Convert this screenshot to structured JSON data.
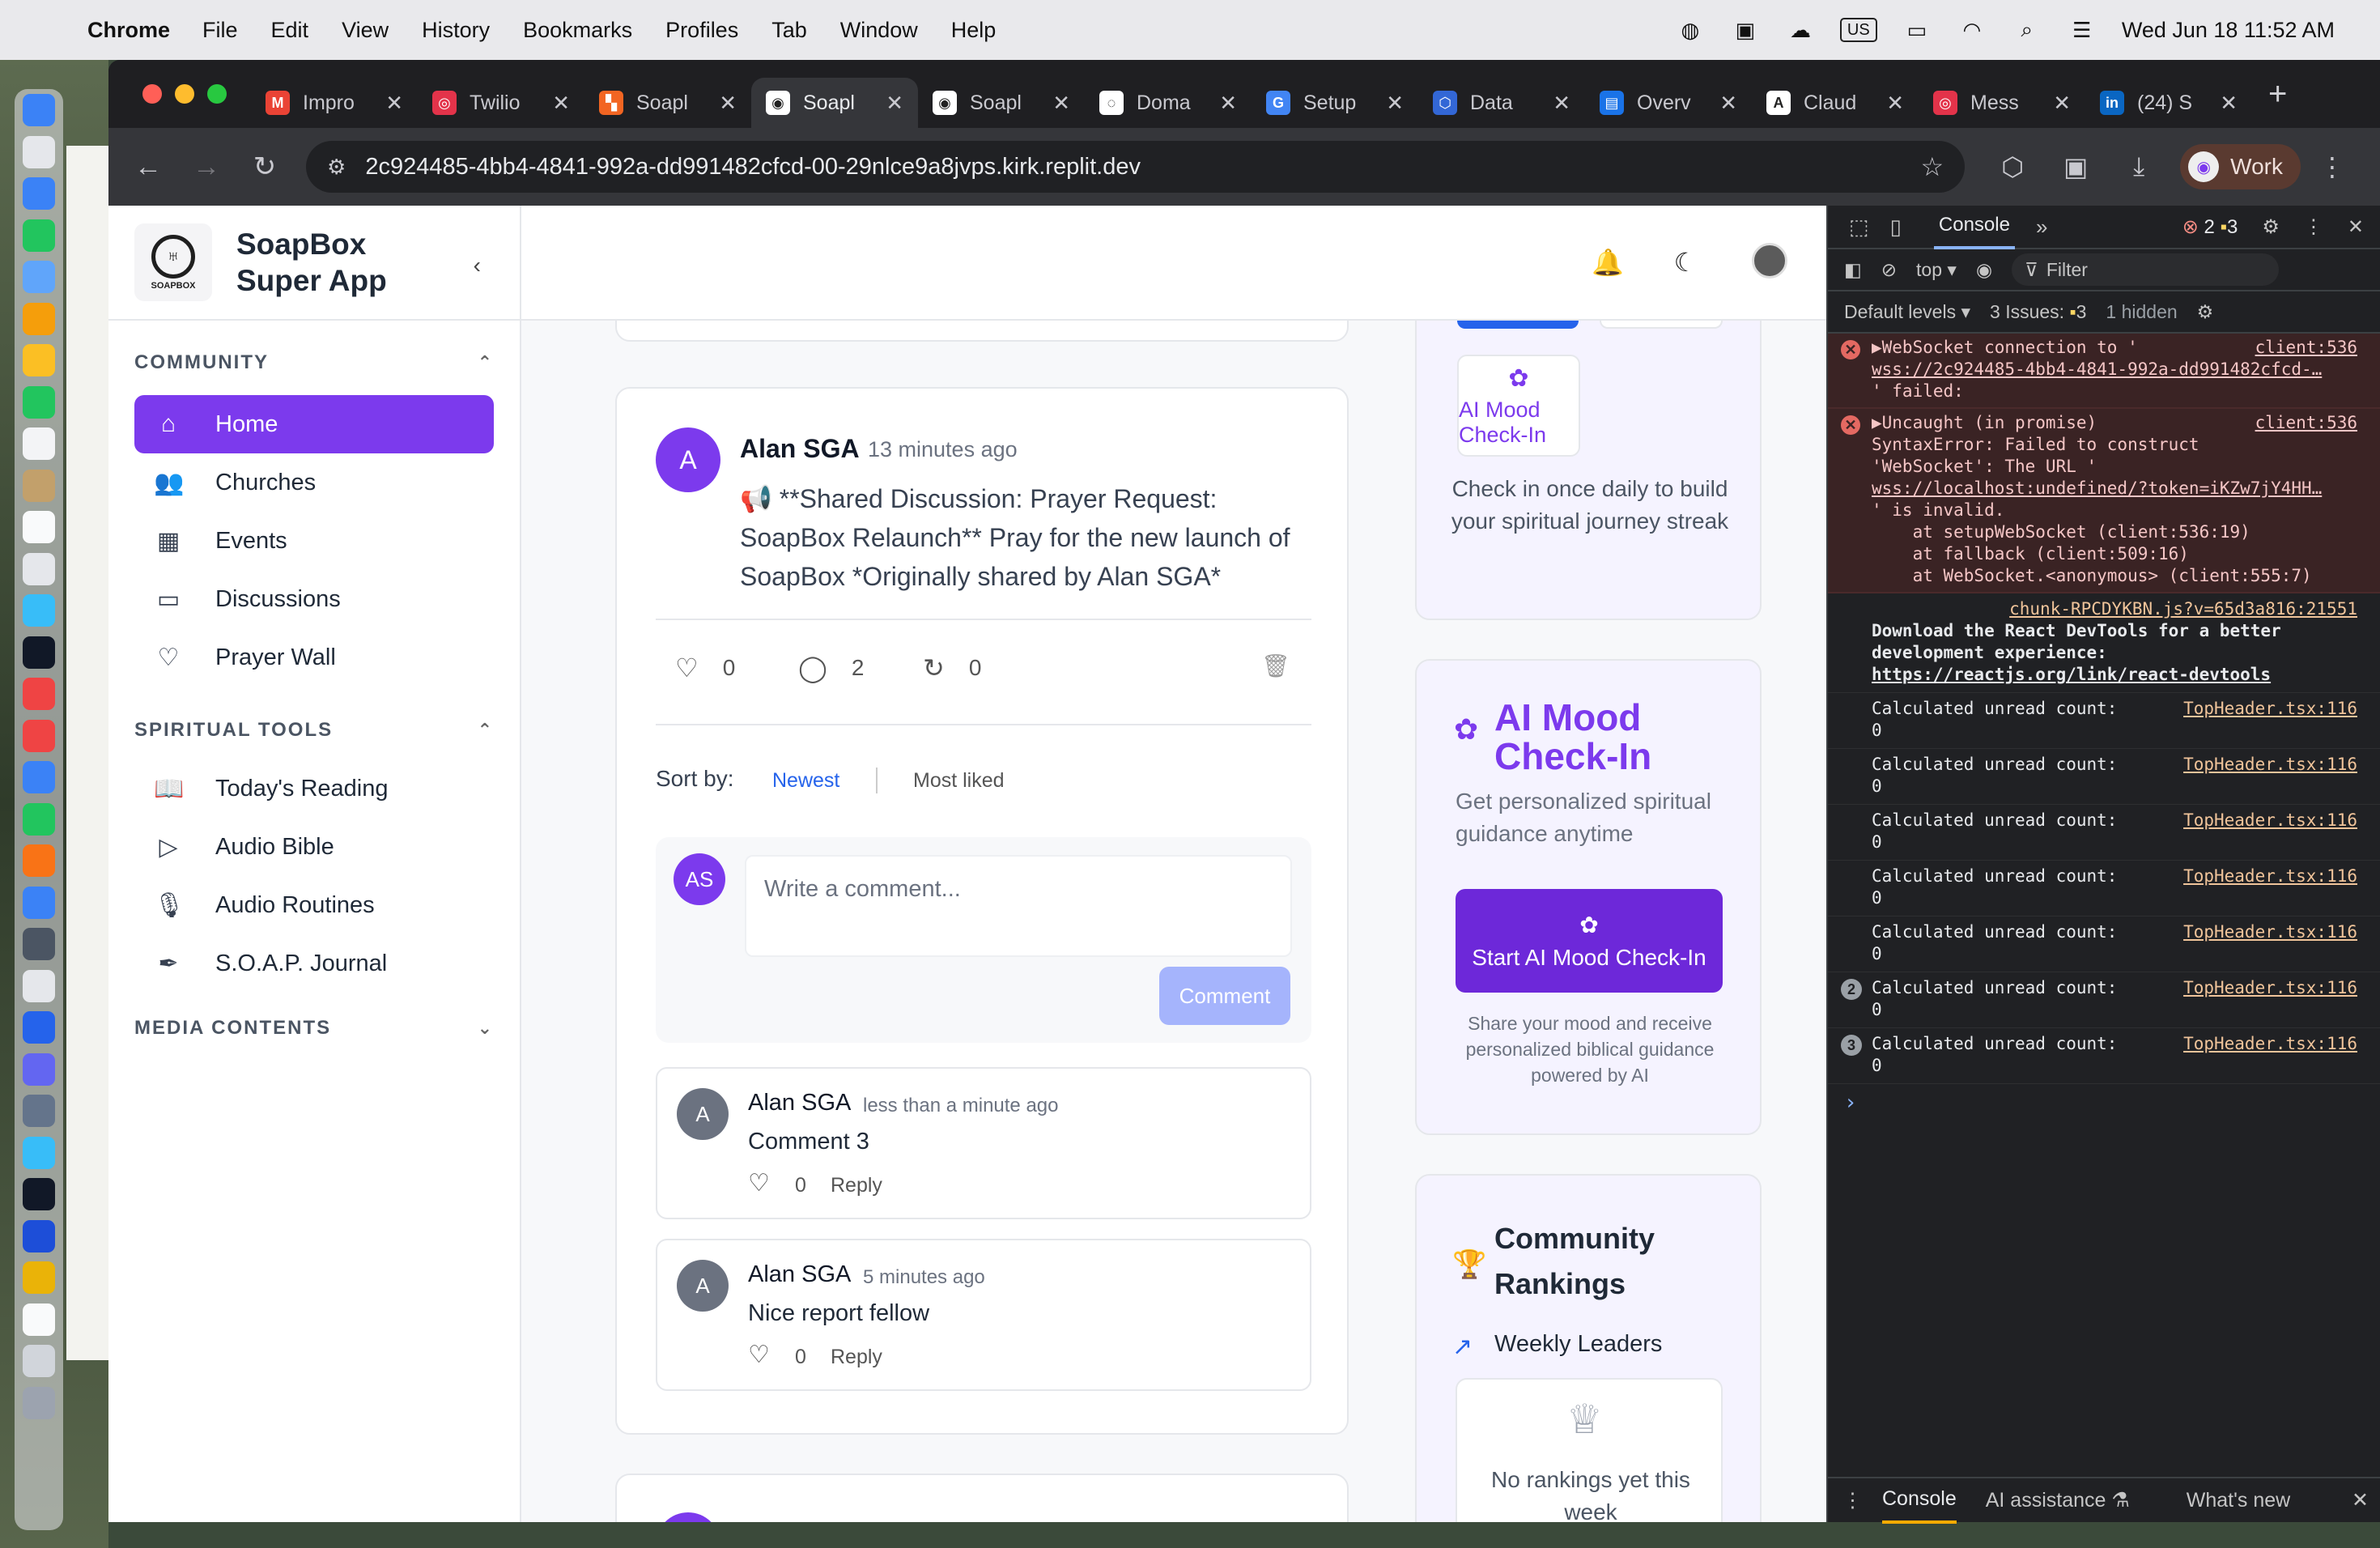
{
  "menubar": {
    "app": "Chrome",
    "items": [
      "File",
      "Edit",
      "View",
      "History",
      "Bookmarks",
      "Profiles",
      "Tab",
      "Window",
      "Help"
    ],
    "input_source": "US",
    "clock": "Wed Jun 18  11:52 AM"
  },
  "tabs": [
    {
      "title": "Impro",
      "color": "#ea4335",
      "glyph": "M"
    },
    {
      "title": "Twilio",
      "color": "#e3334a",
      "glyph": "◎"
    },
    {
      "title": "Soapl",
      "color": "#f26522",
      "glyph": "▚"
    },
    {
      "title": "Soapl",
      "color": "#ffffff",
      "glyph": "◉"
    },
    {
      "title": "Soapl",
      "color": "#ffffff",
      "glyph": "◉"
    },
    {
      "title": "Doma",
      "color": "#ffffff",
      "glyph": "◌"
    },
    {
      "title": "Setup",
      "color": "#4285f4",
      "glyph": "G"
    },
    {
      "title": "Data",
      "color": "#3367d6",
      "glyph": "⬡"
    },
    {
      "title": "Overv",
      "color": "#1a73e8",
      "glyph": "▤"
    },
    {
      "title": "Claud",
      "color": "#ffffff",
      "glyph": "A"
    },
    {
      "title": "Mess",
      "color": "#e3334a",
      "glyph": "◎"
    },
    {
      "title": "(24) S",
      "color": "#0a66c2",
      "glyph": "in"
    }
  ],
  "toolbar": {
    "url": "2c924485-4bb4-4841-992a-dd991482cfcd-00-29nlce9a8jvps.kirk.replit.dev",
    "profile": "Work"
  },
  "sidebar": {
    "brand_name": "SoapBox Super App",
    "logo_text": "SOAPBOX",
    "community_title": "COMMUNITY",
    "community_items": [
      {
        "label": "Home",
        "icon": "home-icon",
        "glyph": "⌂"
      },
      {
        "label": "Churches",
        "icon": "users-icon",
        "glyph": "👥"
      },
      {
        "label": "Events",
        "icon": "calendar-icon",
        "glyph": "▦"
      },
      {
        "label": "Discussions",
        "icon": "message-square-icon",
        "glyph": "▭"
      },
      {
        "label": "Prayer Wall",
        "icon": "heart-icon",
        "glyph": "♡"
      }
    ],
    "tools_title": "SPIRITUAL TOOLS",
    "tools_items": [
      {
        "label": "Today's Reading",
        "icon": "book-open-icon",
        "glyph": "📖"
      },
      {
        "label": "Audio Bible",
        "icon": "play-icon",
        "glyph": "▷"
      },
      {
        "label": "Audio Routines",
        "icon": "mic-icon",
        "glyph": "🎙"
      },
      {
        "label": "S.O.A.P. Journal",
        "icon": "pen-icon",
        "glyph": "✒"
      }
    ],
    "media_title": "MEDIA CONTENTS"
  },
  "post": {
    "avatar": "A",
    "author": "Alan SGA",
    "time": "13 minutes ago",
    "body": "📢 **Shared Discussion: Prayer Request: SoapBox Relaunch** Pray for the new launch of SoapBox *Originally shared by Alan SGA*",
    "likes": "0",
    "comments": "2",
    "reposts": "0",
    "sort_label": "Sort by:",
    "sort_newest": "Newest",
    "sort_most_liked": "Most liked",
    "composer_avatar": "AS",
    "composer_placeholder": "Write a comment...",
    "comment_button": "Comment",
    "comment_list": [
      {
        "avatar": "A",
        "author": "Alan SGA",
        "time": "less than a minute ago",
        "text": "Comment 3",
        "likes": "0",
        "reply": "Reply"
      },
      {
        "avatar": "A",
        "author": "Alan SGA",
        "time": "5 minutes ago",
        "text": "Nice report fellow",
        "likes": "0",
        "reply": "Reply"
      }
    ]
  },
  "widgets": {
    "mood_small_label": "AI Mood Check-In",
    "checkin_text": "Check in once daily to build your spiritual journey streak",
    "mood_title": "AI Mood Check-In",
    "mood_sub": "Get personalized spiritual guidance anytime",
    "mood_button": "Start AI Mood Check-In",
    "mood_note": "Share your mood and receive personalized biblical guidance powered by AI",
    "rankings_title": "Community Rankings",
    "rankings_sub": "Weekly Leaders",
    "rankings_empty": "No rankings yet this week"
  },
  "devtools": {
    "tab": "Console",
    "errors": "2",
    "warnings": "3",
    "context": "top",
    "filter": "Filter",
    "levels": "Default levels",
    "issues": "3 Issues:",
    "issues_count": "3",
    "hidden": "1 hidden",
    "logs": [
      {
        "kind": "err",
        "src": "client:536",
        "lines": [
          "▶WebSocket connection to '",
          "wss://2c924485-4bb4-4841-992a-dd991482cfcd-…",
          "' failed:"
        ]
      },
      {
        "kind": "err",
        "src": "client:536",
        "lines": [
          "▶Uncaught (in promise)",
          "SyntaxError: Failed to construct",
          "'WebSocket': The URL '",
          "wss://localhost:undefined/?token=iKZw7jY4HH…",
          "' is invalid.",
          "    at setupWebSocket (client:536:19)",
          "    at fallback (client:509:16)",
          "    at WebSocket.<anonymous> (client:555:7)"
        ]
      },
      {
        "kind": "info",
        "src": "chunk-RPCDYKBN.js?v=65d3a816:21551",
        "lines": [
          "",
          "Download the React DevTools for a better",
          "development experience:",
          "https://reactjs.org/link/react-devtools"
        ]
      },
      {
        "kind": "info",
        "src": "TopHeader.tsx:116",
        "lines": [
          "Calculated unread count:",
          "0"
        ]
      },
      {
        "kind": "info",
        "src": "TopHeader.tsx:116",
        "lines": [
          "Calculated unread count:",
          "0"
        ]
      },
      {
        "kind": "info",
        "src": "TopHeader.tsx:116",
        "lines": [
          "Calculated unread count:",
          "0"
        ]
      },
      {
        "kind": "info",
        "src": "TopHeader.tsx:116",
        "lines": [
          "Calculated unread count:",
          "0"
        ]
      },
      {
        "kind": "info",
        "src": "TopHeader.tsx:116",
        "lines": [
          "Calculated unread count:",
          "0"
        ]
      },
      {
        "kind": "info",
        "src": "TopHeader.tsx:116",
        "repeat": "2",
        "lines": [
          "Calculated unread count:",
          "0"
        ]
      },
      {
        "kind": "info",
        "src": "TopHeader.tsx:116",
        "repeat": "3",
        "lines": [
          "Calculated unread count:",
          "0"
        ]
      }
    ],
    "drawer_console": "Console",
    "drawer_ai": "AI assistance",
    "drawer_new": "What's new"
  }
}
